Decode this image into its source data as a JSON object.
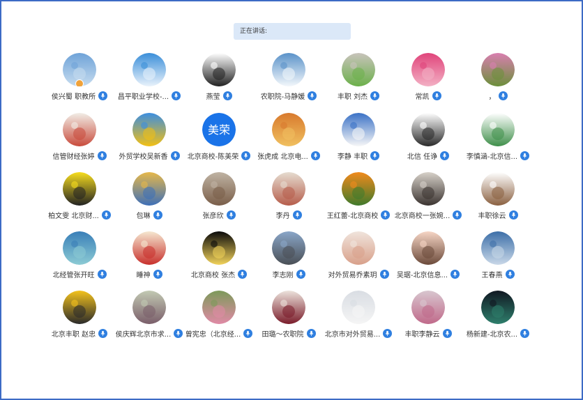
{
  "header": {
    "speaking_label": "正在讲话:"
  },
  "participants": [
    {
      "name": "侯兴蜀 职教所",
      "avatar": "sky-icon",
      "colors": [
        "#6fa3d8",
        "#c6dcef"
      ]
    },
    {
      "name": "昌平职业学校-...",
      "avatar": "dandelion-icon",
      "colors": [
        "#3b8fd9",
        "#e9f2fb"
      ]
    },
    {
      "name": "燕莹",
      "avatar": "cartoon-girl-icon",
      "colors": [
        "#ffffff",
        "#222222"
      ]
    },
    {
      "name": "农职院-马静媛",
      "avatar": "lake-icon",
      "colors": [
        "#5b93c9",
        "#f3f7fb"
      ]
    },
    {
      "name": "丰职 刘杰",
      "avatar": "leaf-icon",
      "colors": [
        "#c8c3bb",
        "#6bb04a"
      ]
    },
    {
      "name": "常凯",
      "avatar": "pink-flower-icon",
      "colors": [
        "#e0457b",
        "#f3b0c4"
      ]
    },
    {
      "name": "，",
      "avatar": "flowers-icon",
      "colors": [
        "#d97fb0",
        "#6b8f3a"
      ]
    },
    {
      "name": "信管财经张婷",
      "avatar": "drawing-icon",
      "colors": [
        "#f1ede6",
        "#c94b3c"
      ]
    },
    {
      "name": "外贸学校吴新香",
      "avatar": "sunflower-icon",
      "colors": [
        "#3c8ee0",
        "#f3c013"
      ]
    },
    {
      "name": "北京商校-陈美荣",
      "avatar": "text-avatar-icon",
      "colors": [
        "#1a73e8",
        "#ffffff"
      ],
      "text": "美荣"
    },
    {
      "name": "张虎成 北京电...",
      "avatar": "autumn-road-icon",
      "colors": [
        "#d87a2e",
        "#f0c060"
      ]
    },
    {
      "name": "李静 丰职",
      "avatar": "bicycle-icon",
      "colors": [
        "#3b72c6",
        "#f7f7f7"
      ]
    },
    {
      "name": "北信 任诤",
      "avatar": "cartoon-man-icon",
      "colors": [
        "#ffffff",
        "#2a2a2a"
      ]
    },
    {
      "name": "李慎涵-北京信...",
      "avatar": "feather-icon",
      "colors": [
        "#ffffff",
        "#3f8f4a"
      ]
    },
    {
      "name": "柏文雯 北京财...",
      "avatar": "glasses-face-icon",
      "colors": [
        "#f7dd1e",
        "#222222"
      ]
    },
    {
      "name": "包琳",
      "avatar": "dragon-icon",
      "colors": [
        "#e6b84a",
        "#3d6fb8"
      ]
    },
    {
      "name": "张彦欣",
      "avatar": "building-icon",
      "colors": [
        "#bfb3a3",
        "#7a5e49"
      ]
    },
    {
      "name": "李丹",
      "avatar": "square-icon",
      "colors": [
        "#e6dcd0",
        "#b65c4a"
      ]
    },
    {
      "name": "王红蕾-北京商校",
      "avatar": "orange-flowers-icon",
      "colors": [
        "#f18a1c",
        "#3f7a2c"
      ]
    },
    {
      "name": "北京商校一张婉...",
      "avatar": "reading-girl-icon",
      "colors": [
        "#d7d1c9",
        "#3a3330"
      ]
    },
    {
      "name": "丰职徐云",
      "avatar": "cartoon-bun-icon",
      "colors": [
        "#ffffff",
        "#8a6040"
      ]
    },
    {
      "name": "北经管张开旺",
      "avatar": "mountain-lake-icon",
      "colors": [
        "#3a7fb8",
        "#8ccbd4"
      ]
    },
    {
      "name": "睡神",
      "avatar": "anime-icon",
      "colors": [
        "#f5e7d0",
        "#c8302c"
      ]
    },
    {
      "name": "北京商校 张杰",
      "avatar": "fireworks-icon",
      "colors": [
        "#0b0b0b",
        "#f2d35a"
      ]
    },
    {
      "name": "李志刚",
      "avatar": "road-icon",
      "colors": [
        "#8aa6c8",
        "#4a4f55"
      ]
    },
    {
      "name": "对外贸易乔素玥",
      "avatar": "child-icon",
      "colors": [
        "#f0e4dc",
        "#d8a08a"
      ]
    },
    {
      "name": "吴琚-北京信息...",
      "avatar": "portrait-icon",
      "colors": [
        "#f6d5c5",
        "#6b4a3a"
      ]
    },
    {
      "name": "王春燕",
      "avatar": "sea-icon",
      "colors": [
        "#3d6fa8",
        "#c9d8e8"
      ]
    },
    {
      "name": "北京丰职 赵忠",
      "avatar": "kungfu-panda-icon",
      "colors": [
        "#f3c21d",
        "#2a2a2a"
      ]
    },
    {
      "name": "侯庆辉北京市求...",
      "avatar": "garden-icon",
      "colors": [
        "#c2c9b3",
        "#7a5e6a"
      ]
    },
    {
      "name": "曾宪忠（北京经...",
      "avatar": "garden-pink-icon",
      "colors": [
        "#7d9a5a",
        "#e08aa6"
      ]
    },
    {
      "name": "田璐～农职院",
      "avatar": "sunglasses-icon",
      "colors": [
        "#ece3dc",
        "#7a1c2a"
      ]
    },
    {
      "name": "北京市对外贸易...",
      "avatar": "girl-icon",
      "colors": [
        "#d9dde3",
        "#f5f5f5"
      ]
    },
    {
      "name": "丰职李静云",
      "avatar": "blossom-icon",
      "colors": [
        "#d8c6cf",
        "#c06a8a"
      ]
    },
    {
      "name": "杨新建-北京农...",
      "avatar": "dark-art-icon",
      "colors": [
        "#111822",
        "#2e7f6c"
      ]
    }
  ]
}
